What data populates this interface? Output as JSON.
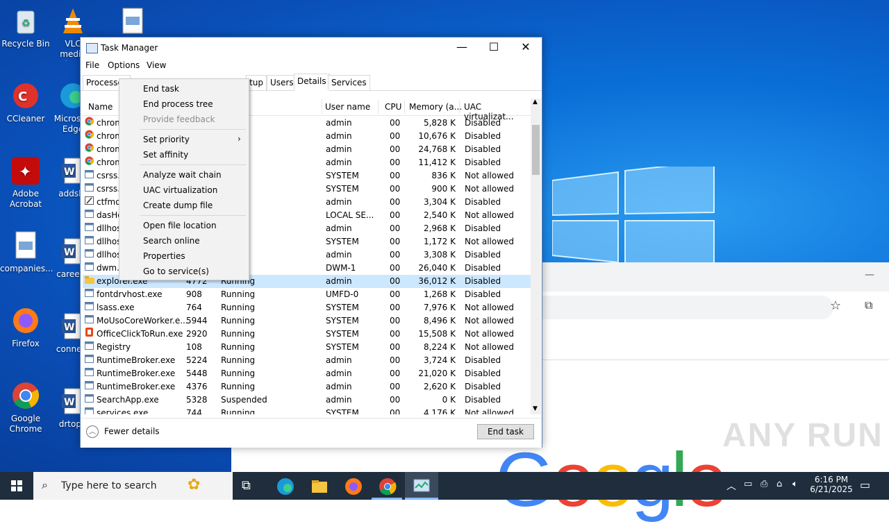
{
  "desktop": {
    "icons": [
      {
        "label": "Recycle Bin"
      },
      {
        "label": "VLC media player"
      },
      {
        "label": ""
      },
      {
        "label": "CCleaner"
      },
      {
        "label": "Microsoft Edge"
      },
      {
        "label": "Adobe Acrobat"
      },
      {
        "label": "addsh"
      },
      {
        "label": "companies..."
      },
      {
        "label": "careerf"
      },
      {
        "label": "Firefox"
      },
      {
        "label": "connec"
      },
      {
        "label": "Google Chrome"
      },
      {
        "label": "drtopi"
      }
    ],
    "watermark": "ANY RUN"
  },
  "task_manager": {
    "title": "Task Manager",
    "menu": [
      "File",
      "Options",
      "View"
    ],
    "tabs": [
      "Processes",
      "Startup",
      "Users",
      "Details",
      "Services"
    ],
    "active_tab": "Details",
    "columns": [
      "Name",
      "User name",
      "CPU",
      "Memory (a...",
      "UAC virtualizat..."
    ],
    "rows": [
      {
        "name": "chrom",
        "pid": "",
        "status": "g",
        "user": "admin",
        "cpu": "00",
        "mem": "5,828 K",
        "uac": "Disabled",
        "icon": "chrome"
      },
      {
        "name": "chrom",
        "pid": "",
        "status": "g",
        "user": "admin",
        "cpu": "00",
        "mem": "10,676 K",
        "uac": "Disabled",
        "icon": "chrome"
      },
      {
        "name": "chrom",
        "pid": "",
        "status": "g",
        "user": "admin",
        "cpu": "00",
        "mem": "24,768 K",
        "uac": "Disabled",
        "icon": "chrome"
      },
      {
        "name": "chrom",
        "pid": "",
        "status": "g",
        "user": "admin",
        "cpu": "00",
        "mem": "11,412 K",
        "uac": "Disabled",
        "icon": "chrome"
      },
      {
        "name": "csrss.e",
        "pid": "",
        "status": "g",
        "user": "SYSTEM",
        "cpu": "00",
        "mem": "836 K",
        "uac": "Not allowed",
        "icon": "app"
      },
      {
        "name": "csrss.e",
        "pid": "",
        "status": "g",
        "user": "SYSTEM",
        "cpu": "00",
        "mem": "900 K",
        "uac": "Not allowed",
        "icon": "app"
      },
      {
        "name": "ctfmo",
        "pid": "",
        "status": "g",
        "user": "admin",
        "cpu": "00",
        "mem": "3,304 K",
        "uac": "Disabled",
        "icon": "edit"
      },
      {
        "name": "dasHo",
        "pid": "",
        "status": "g",
        "user": "LOCAL SE...",
        "cpu": "00",
        "mem": "2,540 K",
        "uac": "Not allowed",
        "icon": "app"
      },
      {
        "name": "dllhos",
        "pid": "",
        "status": "g",
        "user": "admin",
        "cpu": "00",
        "mem": "2,968 K",
        "uac": "Disabled",
        "icon": "app"
      },
      {
        "name": "dllhos",
        "pid": "",
        "status": "g",
        "user": "SYSTEM",
        "cpu": "00",
        "mem": "1,172 K",
        "uac": "Not allowed",
        "icon": "app"
      },
      {
        "name": "dllhos",
        "pid": "",
        "status": "g",
        "user": "admin",
        "cpu": "00",
        "mem": "3,308 K",
        "uac": "Disabled",
        "icon": "app"
      },
      {
        "name": "dwm.e",
        "pid": "",
        "status": "g",
        "user": "DWM-1",
        "cpu": "00",
        "mem": "26,040 K",
        "uac": "Disabled",
        "icon": "app"
      },
      {
        "name": "explorer.exe",
        "pid": "4772",
        "status": "Running",
        "user": "admin",
        "cpu": "00",
        "mem": "36,012 K",
        "uac": "Disabled",
        "icon": "folder",
        "selected": true
      },
      {
        "name": "fontdrvhost.exe",
        "pid": "908",
        "status": "Running",
        "user": "UMFD-0",
        "cpu": "00",
        "mem": "1,268 K",
        "uac": "Disabled",
        "icon": "app"
      },
      {
        "name": "lsass.exe",
        "pid": "764",
        "status": "Running",
        "user": "SYSTEM",
        "cpu": "00",
        "mem": "7,976 K",
        "uac": "Not allowed",
        "icon": "app"
      },
      {
        "name": "MoUsoCoreWorker.e...",
        "pid": "5944",
        "status": "Running",
        "user": "SYSTEM",
        "cpu": "00",
        "mem": "8,496 K",
        "uac": "Not allowed",
        "icon": "app"
      },
      {
        "name": "OfficeClickToRun.exe",
        "pid": "2920",
        "status": "Running",
        "user": "SYSTEM",
        "cpu": "00",
        "mem": "15,508 K",
        "uac": "Not allowed",
        "icon": "office"
      },
      {
        "name": "Registry",
        "pid": "108",
        "status": "Running",
        "user": "SYSTEM",
        "cpu": "00",
        "mem": "8,224 K",
        "uac": "Not allowed",
        "icon": "app"
      },
      {
        "name": "RuntimeBroker.exe",
        "pid": "5224",
        "status": "Running",
        "user": "admin",
        "cpu": "00",
        "mem": "3,724 K",
        "uac": "Disabled",
        "icon": "app"
      },
      {
        "name": "RuntimeBroker.exe",
        "pid": "5448",
        "status": "Running",
        "user": "admin",
        "cpu": "00",
        "mem": "21,020 K",
        "uac": "Disabled",
        "icon": "app"
      },
      {
        "name": "RuntimeBroker.exe",
        "pid": "4376",
        "status": "Running",
        "user": "admin",
        "cpu": "00",
        "mem": "2,620 K",
        "uac": "Disabled",
        "icon": "app"
      },
      {
        "name": "SearchApp.exe",
        "pid": "5328",
        "status": "Suspended",
        "user": "admin",
        "cpu": "00",
        "mem": "0 K",
        "uac": "Disabled",
        "icon": "app"
      },
      {
        "name": "services.exe",
        "pid": "744",
        "status": "Running",
        "user": "SYSTEM",
        "cpu": "00",
        "mem": "4,176 K",
        "uac": "Not allowed",
        "icon": "app"
      }
    ],
    "footer": {
      "fewer_details": "Fewer details",
      "end_task": "End task"
    }
  },
  "context_menu": {
    "items": [
      {
        "label": "End task",
        "enabled": true
      },
      {
        "label": "End process tree",
        "enabled": true
      },
      {
        "label": "Provide feedback",
        "enabled": false
      },
      {
        "label": "Set priority",
        "enabled": true,
        "submenu": true
      },
      {
        "label": "Set affinity",
        "enabled": true
      },
      {
        "label": "Analyze wait chain",
        "enabled": true
      },
      {
        "label": "UAC virtualization",
        "enabled": true
      },
      {
        "label": "Create dump file",
        "enabled": true
      },
      {
        "label": "Open file location",
        "enabled": true
      },
      {
        "label": "Search online",
        "enabled": true
      },
      {
        "label": "Properties",
        "enabled": true
      },
      {
        "label": "Go to service(s)",
        "enabled": true
      }
    ]
  },
  "taskbar": {
    "search_placeholder": "Type here to search",
    "time": "6:16 PM",
    "date": "6/21/2025"
  },
  "colors": {
    "accent": "#0078d7",
    "selection": "#cce8ff",
    "taskbar": "#1f2d3d"
  }
}
